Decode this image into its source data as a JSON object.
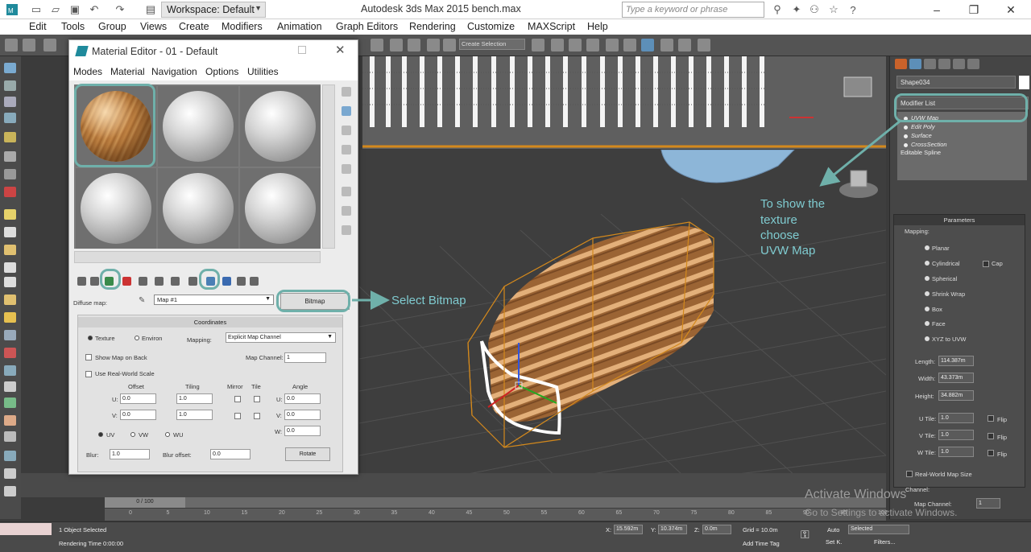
{
  "titlebar": {
    "workspace_label": "Workspace: Default",
    "app_title": "Autodesk 3ds Max  2015     bench.max",
    "search_placeholder": "Type a keyword or phrase"
  },
  "menubar": {
    "items": [
      "Edit",
      "Tools",
      "Group",
      "Views",
      "Create",
      "Modifiers",
      "Animation",
      "Graph Editors",
      "Rendering",
      "Customize",
      "MAXScript",
      "Help"
    ]
  },
  "main_toolbar": {
    "selection_set": "Create Selection"
  },
  "material_editor": {
    "title": "Material Editor - 01 - Default",
    "menu": [
      "Modes",
      "Material",
      "Navigation",
      "Options",
      "Utilities"
    ],
    "diffuse_label": "Diffuse map:",
    "map_name": "Map #1",
    "bitmap_button": "Bitmap",
    "coordinates": {
      "header": "Coordinates",
      "texture": "Texture",
      "environ": "Environ",
      "mapping_label": "Mapping:",
      "mapping_value": "Explicit Map Channel",
      "show_map_on_back": "Show Map on Back",
      "map_channel_label": "Map Channel:",
      "map_channel_value": "1",
      "real_world_scale": "Use Real-World Scale",
      "offset": "Offset",
      "tiling": "Tiling",
      "mirror": "Mirror",
      "tile": "Tile",
      "angle": "Angle",
      "u": "U:",
      "v": "V:",
      "w": "W:",
      "u_offset": "0.0",
      "v_offset": "0.0",
      "u_tiling": "1.0",
      "v_tiling": "1.0",
      "u_angle": "0.0",
      "v_angle": "0.0",
      "w_angle": "0.0",
      "uv": "UV",
      "vw": "VW",
      "wu": "WU",
      "blur_label": "Blur:",
      "blur_value": "1.0",
      "blur_offset_label": "Blur offset:",
      "blur_offset_value": "0.0",
      "rotate": "Rotate"
    }
  },
  "annotations": {
    "select_bitmap": "Select Bitmap",
    "uvw_hint": [
      "To show the",
      "texture",
      "choose",
      "UVW Map"
    ]
  },
  "command_panel": {
    "object_name": "Shape034",
    "modifier_list": "Modifier List",
    "stack": [
      "UVW Map",
      "Edit Poly",
      "Surface",
      "CrossSection",
      "Editable Spline"
    ],
    "params_header": "Parameters",
    "mapping_label": "Mapping:",
    "mapping_options": [
      "Planar",
      "Cylindrical",
      "Spherical",
      "Shrink Wrap",
      "Box",
      "Face",
      "XYZ to UVW"
    ],
    "cap": "Cap",
    "length_label": "Length:",
    "length_value": "114.387m",
    "width_label": "Width:",
    "width_value": "43.373m",
    "height_label": "Height:",
    "height_value": "34.882m",
    "u_tile_label": "U Tile:",
    "u_tile": "1.0",
    "v_tile_label": "V Tile:",
    "v_tile": "1.0",
    "w_tile_label": "W Tile:",
    "w_tile": "1.0",
    "flip": "Flip",
    "real_world_map_size": "Real-World Map Size",
    "channel_label": "Channel:",
    "map_channel_label": "Map Channel:",
    "map_channel_value": "1"
  },
  "timeline": {
    "frame": "0 / 100",
    "ticks": [
      "0",
      "5",
      "10",
      "15",
      "20",
      "25",
      "30",
      "35",
      "40",
      "45",
      "50",
      "55",
      "60",
      "65",
      "70",
      "75",
      "80",
      "85",
      "90",
      "95",
      "100"
    ]
  },
  "status": {
    "objects_selected": "1 Object Selected",
    "rendering_time": "Rendering Time  0:00:00",
    "x_label": "X:",
    "x_value": "15.592m",
    "y_label": "Y:",
    "y_value": "10.374m",
    "z_label": "Z:",
    "z_value": "0.0m",
    "grid": "Grid = 10.0m",
    "add_time_tag": "Add Time Tag",
    "auto": "Auto",
    "selected": "Selected",
    "set_k": "Set K.",
    "filters": "Filters..."
  },
  "watermark": {
    "line1": "Activate Windows",
    "line2": "Go to Settings to activate Windows."
  },
  "colors": {
    "accent_teal": "#6fb0aa",
    "annotation_text": "#7fcbd0",
    "wood": "#b5773a",
    "selection_orange": "#d4891c"
  }
}
